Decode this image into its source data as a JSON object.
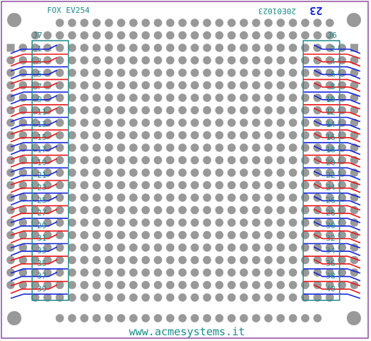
{
  "board": {
    "silkscreen_top_left": "FOX EV254",
    "silkscreen_top_right_mirrored": "20E01023",
    "silkscreen_logo_mirrored": "23",
    "website": "www.acmesystems.it",
    "colors": {
      "outline": "#8a4a9a",
      "pad": "#999999",
      "square_pad": "#9a9a9a",
      "silk": "#1a8a8a",
      "trace_red": "#ee1111",
      "trace_blue": "#1122dd"
    }
  },
  "connectors": {
    "left": {
      "label": "J7",
      "pins": [
        "1",
        "3",
        "5",
        "7",
        "9",
        "11",
        "13",
        "15",
        "17",
        "19",
        "21",
        "23",
        "25",
        "27",
        "29",
        "31",
        "33",
        "35",
        "37",
        "39"
      ]
    },
    "right": {
      "label": "J6",
      "pins": [
        "2",
        "4",
        "6",
        "8",
        "10",
        "12",
        "14",
        "16",
        "18",
        "20",
        "22",
        "24",
        "26",
        "28",
        "30",
        "32",
        "34",
        "36",
        "38",
        "40"
      ]
    }
  }
}
